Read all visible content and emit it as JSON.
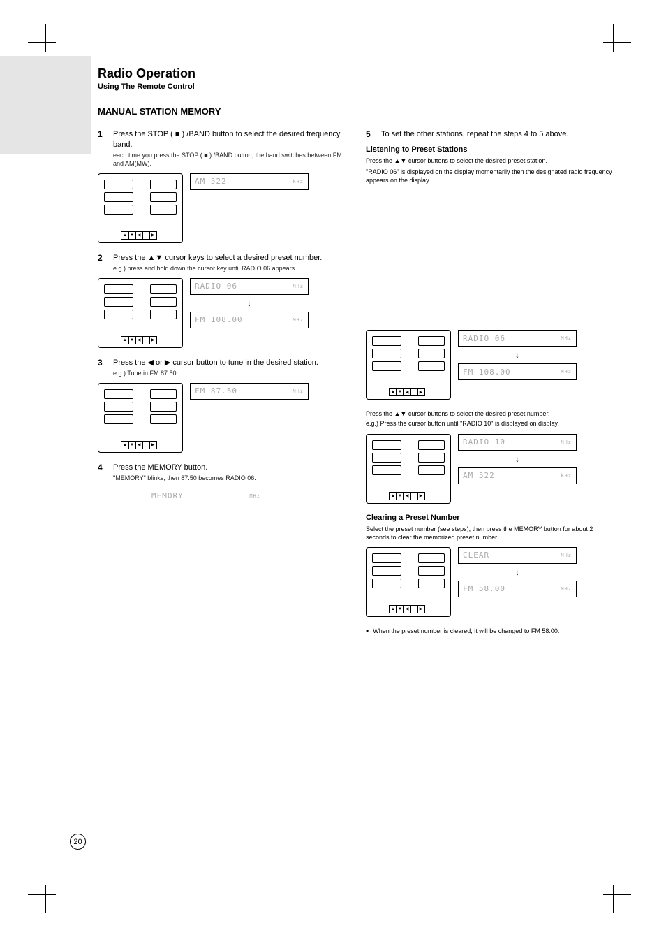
{
  "page": {
    "number": "20",
    "heading": "Radio Operation",
    "subheading": "Using The Remote Control",
    "partTitle": "MANUAL STATION MEMORY",
    "steps": {
      "s1": {
        "line1": "Press the STOP ( ■ ) /BAND button to select the desired frequency band.",
        "sub": "each time you press the STOP ( ■ ) /BAND button, the band switches between FM and AM(MW)."
      },
      "s2": {
        "line1": "Press the ▲▼ cursor keys to select a desired preset number.",
        "sub": "e.g.) press and hold down the cursor key until RADIO 06 appears."
      },
      "s3": {
        "line1": "Press the ◀ or ▶ cursor button to tune in the desired station.",
        "sub": "e.g.) Tune in FM 87.50."
      },
      "s4": {
        "line1": "Press the MEMORY button.",
        "sub": "\"MEMORY\" blinks, then 87.50 becomes RADIO 06."
      },
      "s5": {
        "line1": "Press the ▲▼ cursor buttons to select the desired preset number.",
        "sub": "e.g.) Press the cursor button until \"RADIO 10\" is displayed on display."
      },
      "s6": {
        "line1": "To set the other stations, repeat the steps 4 to 5 above."
      }
    },
    "listening": {
      "title": "Listening to Preset Stations",
      "body": "Press the ▲▼ cursor buttons to select the desired preset station.",
      "note": "\"RADIO 06\" is displayed on the display momentarily then the designated radio frequency appears on the display"
    },
    "clearing": {
      "title": "Clearing a Preset Number",
      "body": "Select the preset number (see steps), then press the MEMORY button for about 2 seconds to clear the memorized preset number.",
      "bullet": "When the preset number is cleared, it will be changed to FM 58.00."
    },
    "lcd": {
      "am522": "AM   522",
      "radio06": "RADIO 06",
      "fm10800": "FM 108.00",
      "fm8750": "FM  87.50",
      "memory": "MEMORY",
      "radio10": "RADIO 10",
      "clear": "CLEAR",
      "fm5800": "FM  58.00",
      "unit_khz": "kHz",
      "unit_mhz": "MHz"
    }
  }
}
